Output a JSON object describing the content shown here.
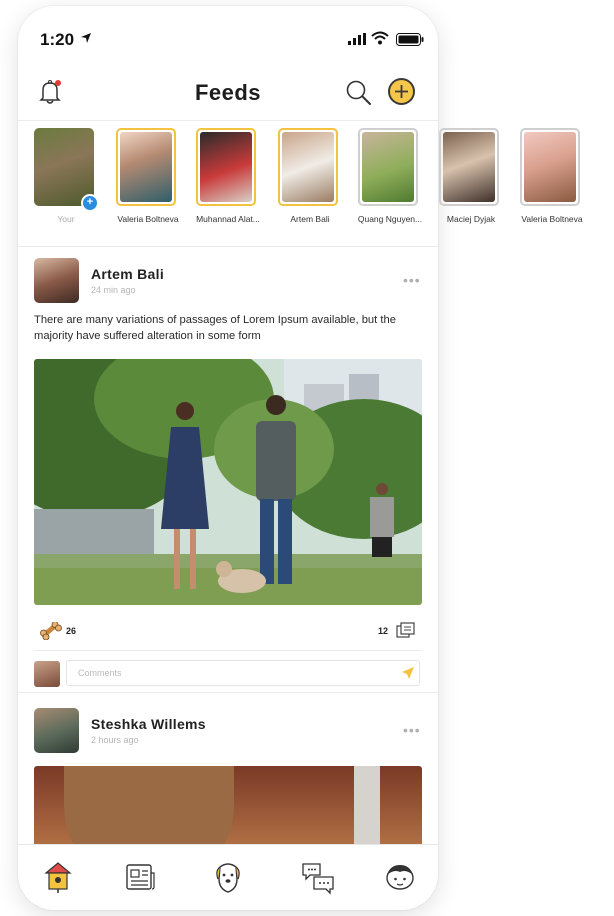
{
  "status": {
    "time": "1:20"
  },
  "header": {
    "title": "Feeds"
  },
  "stories": [
    {
      "name": "Your",
      "state": "own"
    },
    {
      "name": "Valeria Boltneva",
      "state": "active"
    },
    {
      "name": "Muhannad Alat...",
      "state": "active"
    },
    {
      "name": "Artem Bali",
      "state": "active"
    },
    {
      "name": "Quang Nguyen...",
      "state": "seen"
    },
    {
      "name": "Maciej Dyjak",
      "state": "seen"
    },
    {
      "name": "Valeria Boltneva",
      "state": "seen"
    }
  ],
  "posts": [
    {
      "author": "Artem Bali",
      "time": "24 min ago",
      "text": "There are many variations of passages of Lorem Ipsum available, but the majority have suffered alteration in some form",
      "likes": "26",
      "comments": "12",
      "comment_placeholder": "Comments"
    },
    {
      "author": "Steshka Willems",
      "time": "2 hours ago"
    }
  ],
  "more_glyph": "•••",
  "icons": {
    "bell": "bell-icon",
    "search": "search-icon",
    "add": "plus-icon",
    "like": "bone-icon",
    "comments": "comments-icon",
    "send": "send-icon",
    "tabs": [
      "birdhouse-icon",
      "newspaper-icon",
      "dog-icon",
      "chat-bubbles-icon",
      "user-face-icon"
    ]
  },
  "colors": {
    "accent": "#f6c64b",
    "story_active_border": "#f3c241",
    "badge_blue": "#2c8cdf",
    "notification_dot": "#e53935"
  }
}
